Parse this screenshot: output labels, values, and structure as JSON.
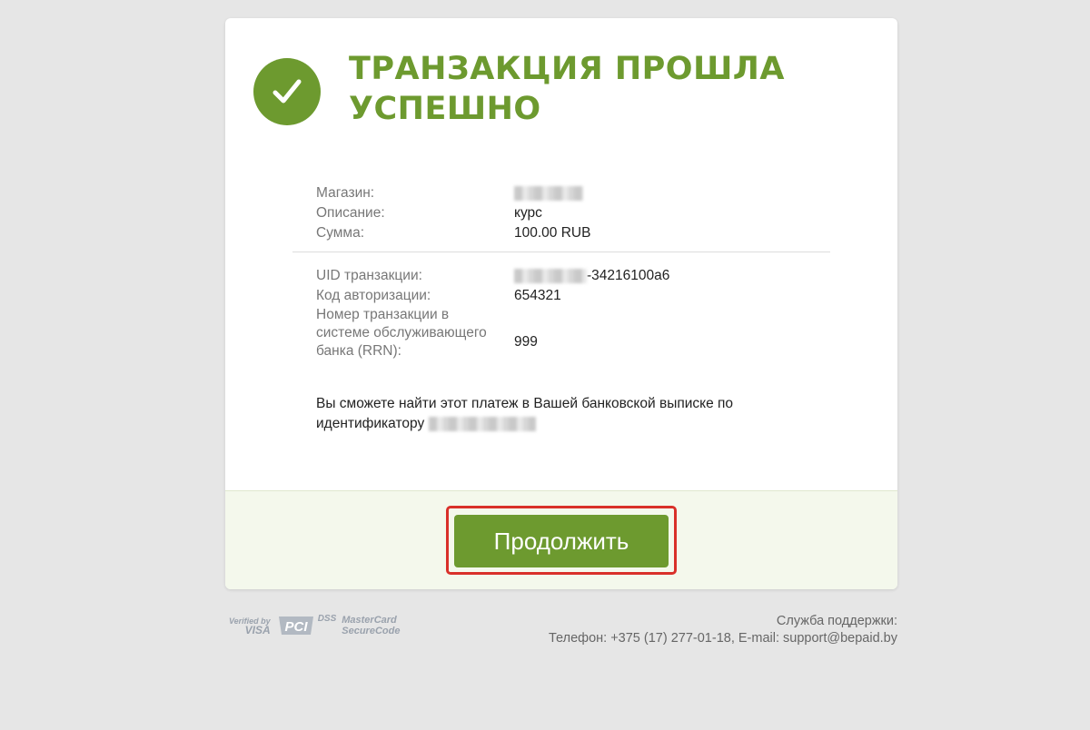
{
  "header": {
    "title": "ТРАНЗАКЦИЯ ПРОШЛА УСПЕШНО",
    "status_icon": "check-circle-icon"
  },
  "order": {
    "store_label": "Магазин:",
    "description_label": "Описание:",
    "description_value": "курс",
    "amount_label": "Сумма:",
    "amount_value": "100.00 RUB"
  },
  "transaction": {
    "uid_label": "UID транзакции:",
    "uid_visible_suffix": "-34216100a6",
    "auth_code_label": "Код авторизации:",
    "auth_code_value": "654321",
    "rrn_label": "Номер транзакции в системе обслуживающего банка (RRN):",
    "rrn_value": "999"
  },
  "note": {
    "text": "Вы сможете найти этот платеж в Вашей банковской выписке по идентификатору"
  },
  "actions": {
    "continue_label": "Продолжить"
  },
  "footer": {
    "logos": {
      "vbv_small": "Verified by",
      "vbv_big": "VISA",
      "pci_letters": "PCI",
      "dss": "DSS",
      "mc_line1": "MasterCard",
      "mc_line2": "SecureCode"
    },
    "support_title": "Служба поддержки:",
    "support_contacts": "Телефон: +375 (17) 277-01-18, E-mail: support@bepaid.by"
  },
  "colors": {
    "accent": "#6d9a2f",
    "highlight": "#d9302a",
    "band": "#f4f8ec"
  }
}
